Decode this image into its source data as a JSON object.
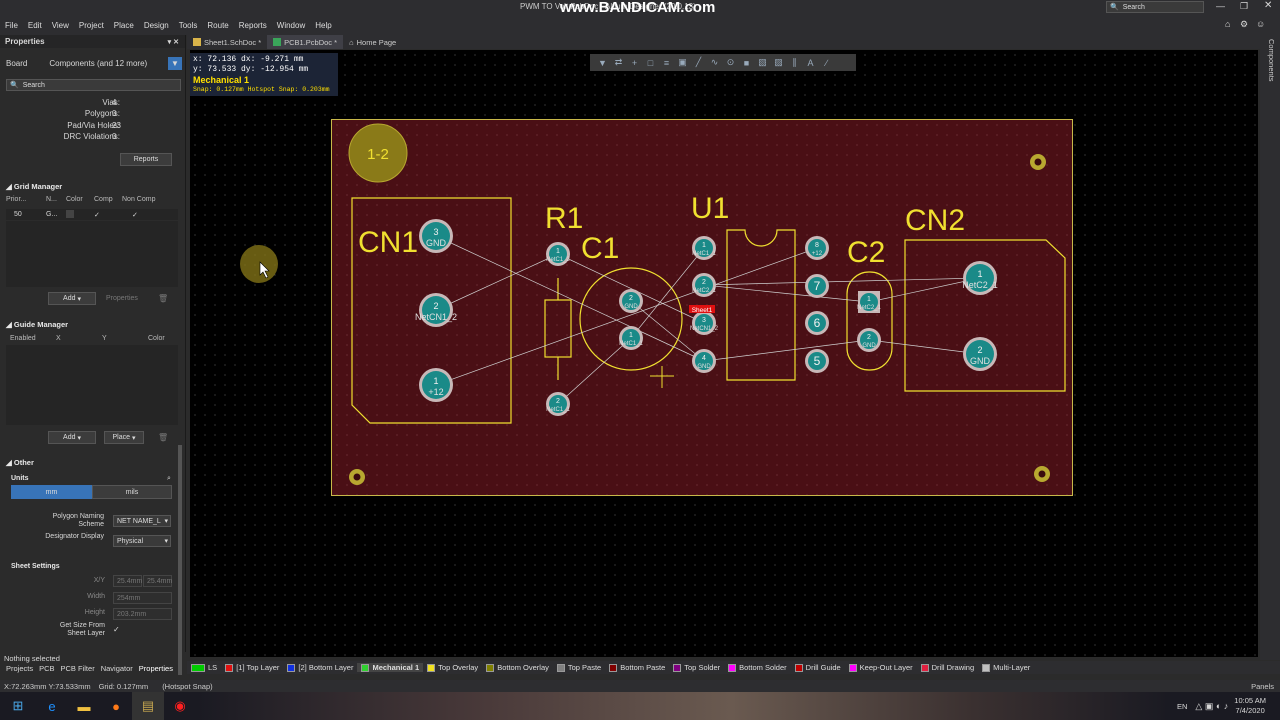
{
  "window": {
    "title": "PWM TO Volt PcbDoc - Altium Designer (20.0.13)",
    "watermark": "www.BANDICAM.com",
    "search_label": "Search"
  },
  "menu": [
    "File",
    "Edit",
    "View",
    "Project",
    "Place",
    "Design",
    "Tools",
    "Route",
    "Reports",
    "Window",
    "Help"
  ],
  "properties": {
    "header": "Properties",
    "board_label": "Board",
    "filter_label": "Components (and 12 more)",
    "search_placeholder": "Search",
    "stats": [
      {
        "label": "Vias:",
        "value": "4"
      },
      {
        "label": "Polygons:",
        "value": "0"
      },
      {
        "label": "Pad/Via Holes:",
        "value": "23"
      },
      {
        "label": "DRC Violations:",
        "value": "0"
      }
    ],
    "reports_button": "Reports",
    "grid_manager": {
      "title": "Grid Manager",
      "columns": [
        "Prior...",
        "N...",
        "Color",
        "Comp",
        "Non Comp"
      ],
      "row": {
        "priority": "50",
        "name": "G..."
      },
      "add": "Add",
      "properties": "Properties"
    },
    "guide_manager": {
      "title": "Guide Manager",
      "columns": [
        "Enabled",
        "X",
        "Y",
        "Color"
      ],
      "add": "Add",
      "place": "Place"
    },
    "other": {
      "title": "Other",
      "units_label": "Units",
      "units": [
        "mm",
        "mils"
      ],
      "polygon_label": "Polygon Naming Scheme",
      "polygon_value": "NET NAME_L",
      "designator_label": "Designator Display",
      "designator_value": "Physical"
    },
    "sheet": {
      "title": "Sheet Settings",
      "xy_label": "X/Y",
      "x": "25.4mm",
      "y": "25.4mm",
      "width_label": "Width",
      "width": "254mm",
      "height_label": "Height",
      "height": "203.2mm",
      "getsize_label": "Get Size From Sheet Layer"
    },
    "nothing_selected": "Nothing selected"
  },
  "doc_tabs": [
    "Sheet1.SchDoc *",
    "PCB1.PcbDoc *",
    "Home Page"
  ],
  "coords": {
    "line1": "x: 72.136   dx: -9.271  mm",
    "line2": "y: 73.533   dy: -12.954  mm",
    "layer": "Mechanical 1",
    "snap": "Snap: 0.127mm Hotspot Snap: 0.203mm"
  },
  "pcb": {
    "designators": [
      "CN1",
      "R1",
      "C1",
      "U1",
      "C2",
      "CN2",
      "1-2"
    ],
    "pads": [
      {
        "num": "3",
        "net": "GND"
      },
      {
        "num": "2",
        "net": "NetCN1_2"
      },
      {
        "num": "1",
        "net": "+12"
      },
      {
        "num": "1",
        "net": "NetC1_2"
      },
      {
        "num": "2",
        "net": "NetC1_1"
      },
      {
        "num": "2",
        "net": "GND"
      },
      {
        "num": "1",
        "net": "NetC1_1"
      },
      {
        "num": "1",
        "net": "NetC1_1"
      },
      {
        "num": "2",
        "net": "NetC2_1"
      },
      {
        "num": "3",
        "net": "NetCN1_2"
      },
      {
        "num": "4",
        "net": "GND"
      },
      {
        "num": "8",
        "net": "+12"
      },
      {
        "num": "7",
        "net": ""
      },
      {
        "num": "6",
        "net": ""
      },
      {
        "num": "5",
        "net": ""
      },
      {
        "num": "1",
        "net": "NetC2_1"
      },
      {
        "num": "2",
        "net": "GND"
      },
      {
        "num": "1",
        "net": "NetC2_1"
      },
      {
        "num": "2",
        "net": "GND"
      }
    ],
    "sheet_label": "Sheet1"
  },
  "layers": [
    {
      "name": "LS",
      "color": "#00cc00"
    },
    {
      "name": "[1] Top Layer",
      "color": "#e01010"
    },
    {
      "name": "[2] Bottom Layer",
      "color": "#1030e0"
    },
    {
      "name": "Mechanical 1",
      "color": "#30d030"
    },
    {
      "name": "Top Overlay",
      "color": "#f0e020"
    },
    {
      "name": "Bottom Overlay",
      "color": "#808000"
    },
    {
      "name": "Top Paste",
      "color": "#808080"
    },
    {
      "name": "Bottom Paste",
      "color": "#800000"
    },
    {
      "name": "Top Solder",
      "color": "#800080"
    },
    {
      "name": "Bottom Solder",
      "color": "#ff00ff"
    },
    {
      "name": "Drill Guide",
      "color": "#c00000"
    },
    {
      "name": "Keep-Out Layer",
      "color": "#ff00ff"
    },
    {
      "name": "Drill Drawing",
      "color": "#e02040"
    },
    {
      "name": "Multi-Layer",
      "color": "#c0c0c0"
    }
  ],
  "bottom_tabs": [
    "Projects",
    "PCB",
    "PCB Filter",
    "Navigator",
    "Properties"
  ],
  "status": {
    "coords": "X:72.263mm Y:73.533mm",
    "grid": "Grid: 0.127mm",
    "snap": "(Hotspot Snap)",
    "panels": "Panels"
  },
  "taskbar": {
    "lang": "EN",
    "time": "10:05 AM",
    "date": "7/4/2020"
  },
  "right_strip_label": "Components"
}
